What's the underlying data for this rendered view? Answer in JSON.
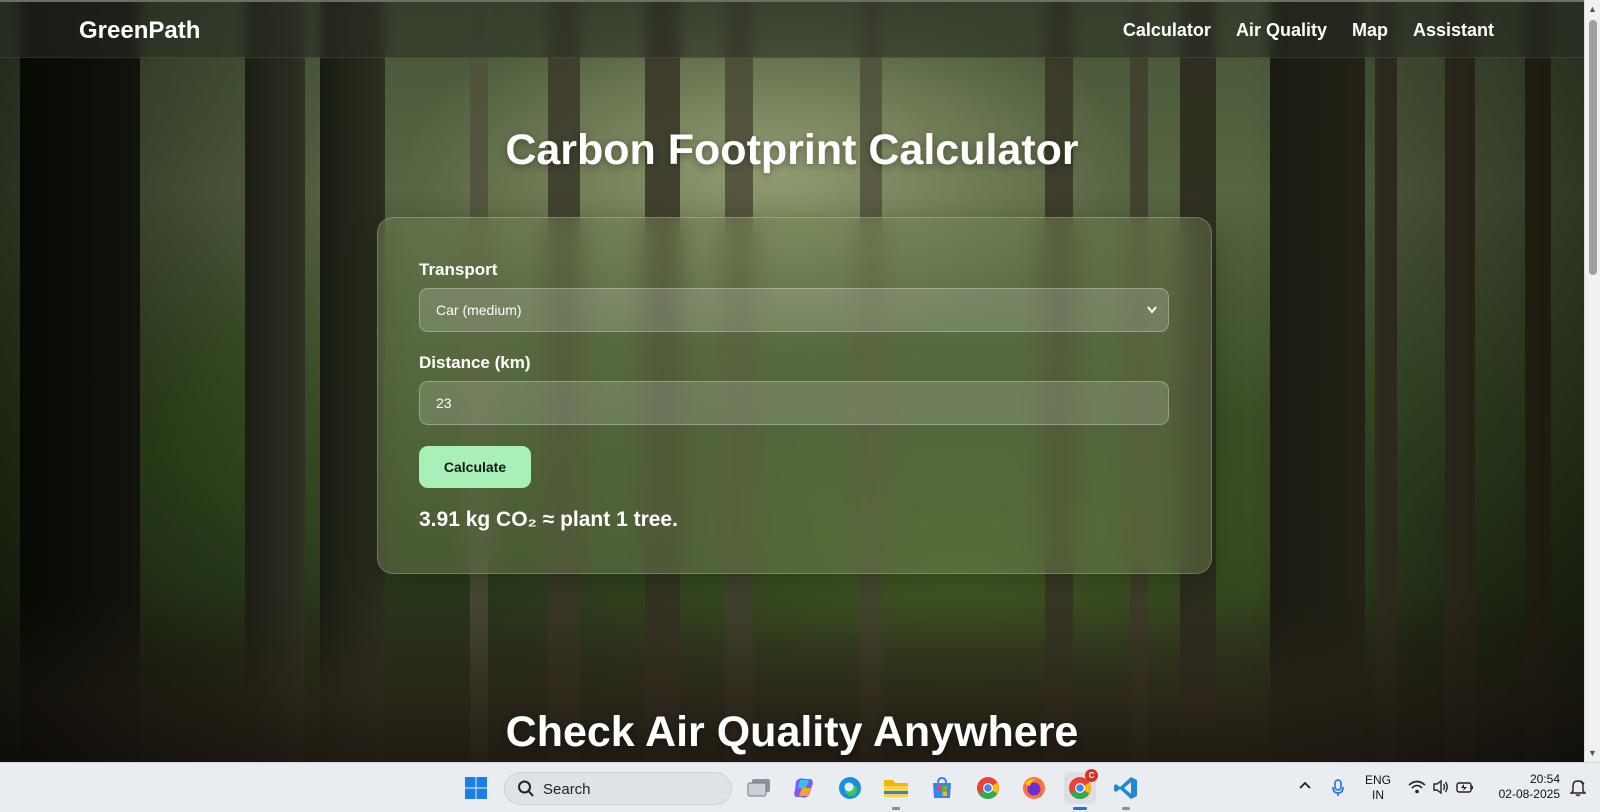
{
  "navbar": {
    "brand": "GreenPath",
    "links": [
      "Calculator",
      "Air Quality",
      "Map",
      "Assistant"
    ]
  },
  "calculator": {
    "title": "Carbon Footprint Calculator",
    "transport_label": "Transport",
    "transport_selected": "Car (medium)",
    "distance_label": "Distance (km)",
    "distance_value": "23",
    "button_label": "Calculate",
    "result": "3.91 kg CO₂ ≈ plant 1 tree."
  },
  "air_quality": {
    "title": "Check Air Quality Anywhere"
  },
  "taskbar": {
    "search_label": "Search",
    "language_line1": "ENG",
    "language_line2": "IN",
    "time": "20:54",
    "date": "02-08-2025",
    "chrome_badge": "C",
    "icons": [
      "windows-start-icon",
      "search-icon",
      "task-view-icon",
      "copilot-icon",
      "edge-icon",
      "file-explorer-icon",
      "store-icon",
      "chrome-icon",
      "firefox-icon",
      "chrome-profile-icon",
      "vscode-icon"
    ],
    "tray_icons": [
      "chevron-up-icon",
      "microphone-icon",
      "wifi-icon",
      "volume-icon",
      "battery-icon",
      "notification-icon"
    ]
  },
  "colors": {
    "button_bg": "#a8f0b8",
    "taskbar_bg": "#e9edf2",
    "vscode_blue": "#1f8ad2",
    "chrome_active_indicator": "#1a73e8"
  }
}
